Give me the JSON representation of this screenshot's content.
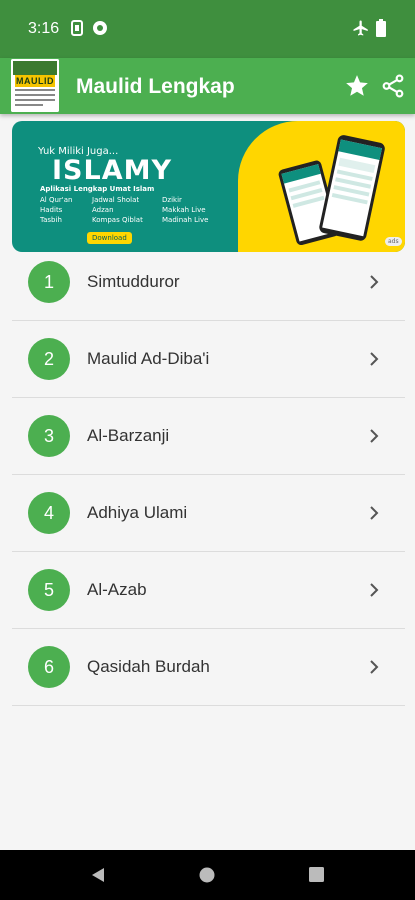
{
  "status": {
    "time": "3:16"
  },
  "app": {
    "title": "Maulid Lengkap",
    "logo_text": "MAULID"
  },
  "banner": {
    "tagline": "Yuk Miliki Juga...",
    "headline": "ISLAMY",
    "subtitle": "Aplikasi Lengkap Umat Islam",
    "features": [
      "Al Qur'an",
      "Hadits",
      "Tasbih",
      "Jadwal Sholat",
      "Adzan",
      "Kompas Qiblat",
      "Dzikir",
      "Makkah Live",
      "Madinah Live"
    ],
    "button": "Download",
    "ad_badge": "ads"
  },
  "list": {
    "items": [
      {
        "number": "1",
        "label": "Simtudduror"
      },
      {
        "number": "2",
        "label": "Maulid Ad-Diba'i"
      },
      {
        "number": "3",
        "label": "Al-Barzanji"
      },
      {
        "number": "4",
        "label": "Adhiya Ulami"
      },
      {
        "number": "5",
        "label": "Al-Azab"
      },
      {
        "number": "6",
        "label": "Qasidah Burdah"
      }
    ]
  },
  "colors": {
    "primary": "#4caf50",
    "status_bar": "#3f8f3e",
    "banner_teal": "#0e8f7e",
    "banner_yellow": "#ffd600"
  }
}
